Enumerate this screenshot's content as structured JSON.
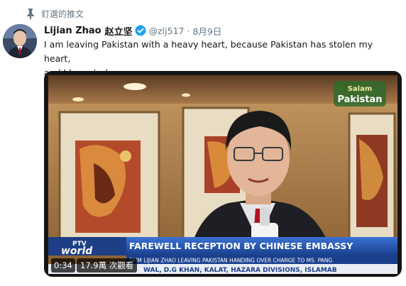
{
  "pinned": {
    "label": "釘選的推文",
    "icon": "pin-icon"
  },
  "author": {
    "name": "Lijian Zhao",
    "name_cjk": "赵立坚",
    "handle": "@zlj517",
    "separator": "·",
    "date": "8月9日",
    "verified_icon": "verified-badge-icon"
  },
  "tweet": {
    "line1": "I am leaving Pakistan with a heavy heart, because Pakistan has stolen my heart,",
    "line2": "and I have to leave now."
  },
  "video": {
    "time": "0:34",
    "views": "17.9萬 次觀看",
    "overlay": {
      "channel_logo_top": "PTV",
      "channel_logo_bottom": "world",
      "headline": "FAREWELL RECEPTION BY CHINESE EMBASSY",
      "subline": "DHM LIJIAN ZHAO LEAVING PAKISTAN HANDING OVER CHARGE TO MS. PANG",
      "ticker": "WAL, D.G KHAN, KALAT, HAZARA DIVISIONS, ISLAMAB",
      "corner_logo_top": "Salam",
      "corner_logo_bottom": "Pakistan"
    }
  },
  "colors": {
    "accent": "#1da1f2",
    "muted_text": "#657786",
    "banner_blue": "#1e4fa8",
    "ticker_bg": "#e9eef5"
  }
}
